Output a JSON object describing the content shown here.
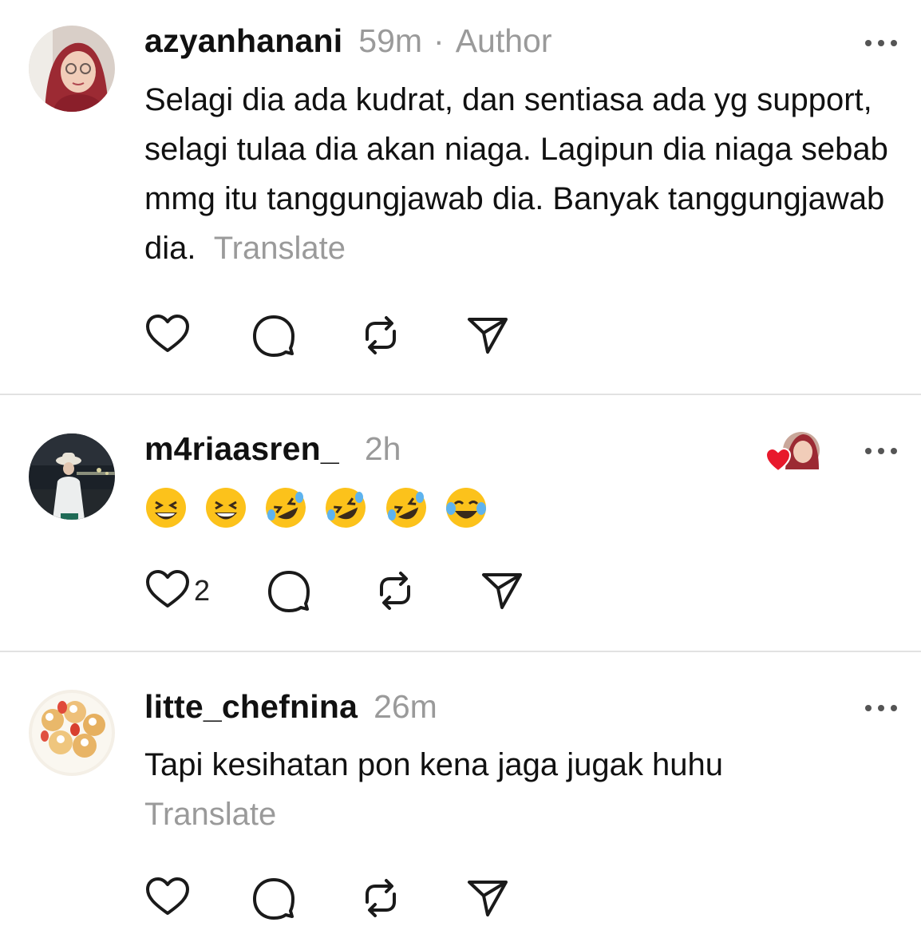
{
  "posts": [
    {
      "username": "azyanhanani",
      "time": "59m",
      "separator": "·",
      "author_tag": "Author",
      "text": "Selagi dia ada kudrat, dan sentiasa ada yg support, selagi tulaa dia akan niaga. Lagipun dia niaga sebab mmg itu tanggungjawab dia. Banyak tanggungjawab dia.",
      "translate": "Translate",
      "avatar_icon": "avatar-photo-hijab-woman"
    },
    {
      "username": "m4riaasren_",
      "time": "2h",
      "emojis": [
        "😆",
        "😆",
        "🤣",
        "🤣",
        "🤣",
        "😂"
      ],
      "like_count": "2",
      "liked_by_author_icon": "heart-badge-icon",
      "avatar_icon": "avatar-photo-night-beach"
    },
    {
      "username": "litte_chefnina",
      "time": "26m",
      "text": "Tapi kesihatan pon kena jaga jugak huhu",
      "translate": "Translate",
      "avatar_icon": "avatar-photo-cream-puffs"
    }
  ],
  "action_icons": [
    "heart-icon",
    "comment-icon",
    "repost-icon",
    "share-icon"
  ],
  "colors": {
    "text": "#111111",
    "muted": "#9a9a9a",
    "divider": "#e2e2e2",
    "heart_red": "#e8192c"
  }
}
